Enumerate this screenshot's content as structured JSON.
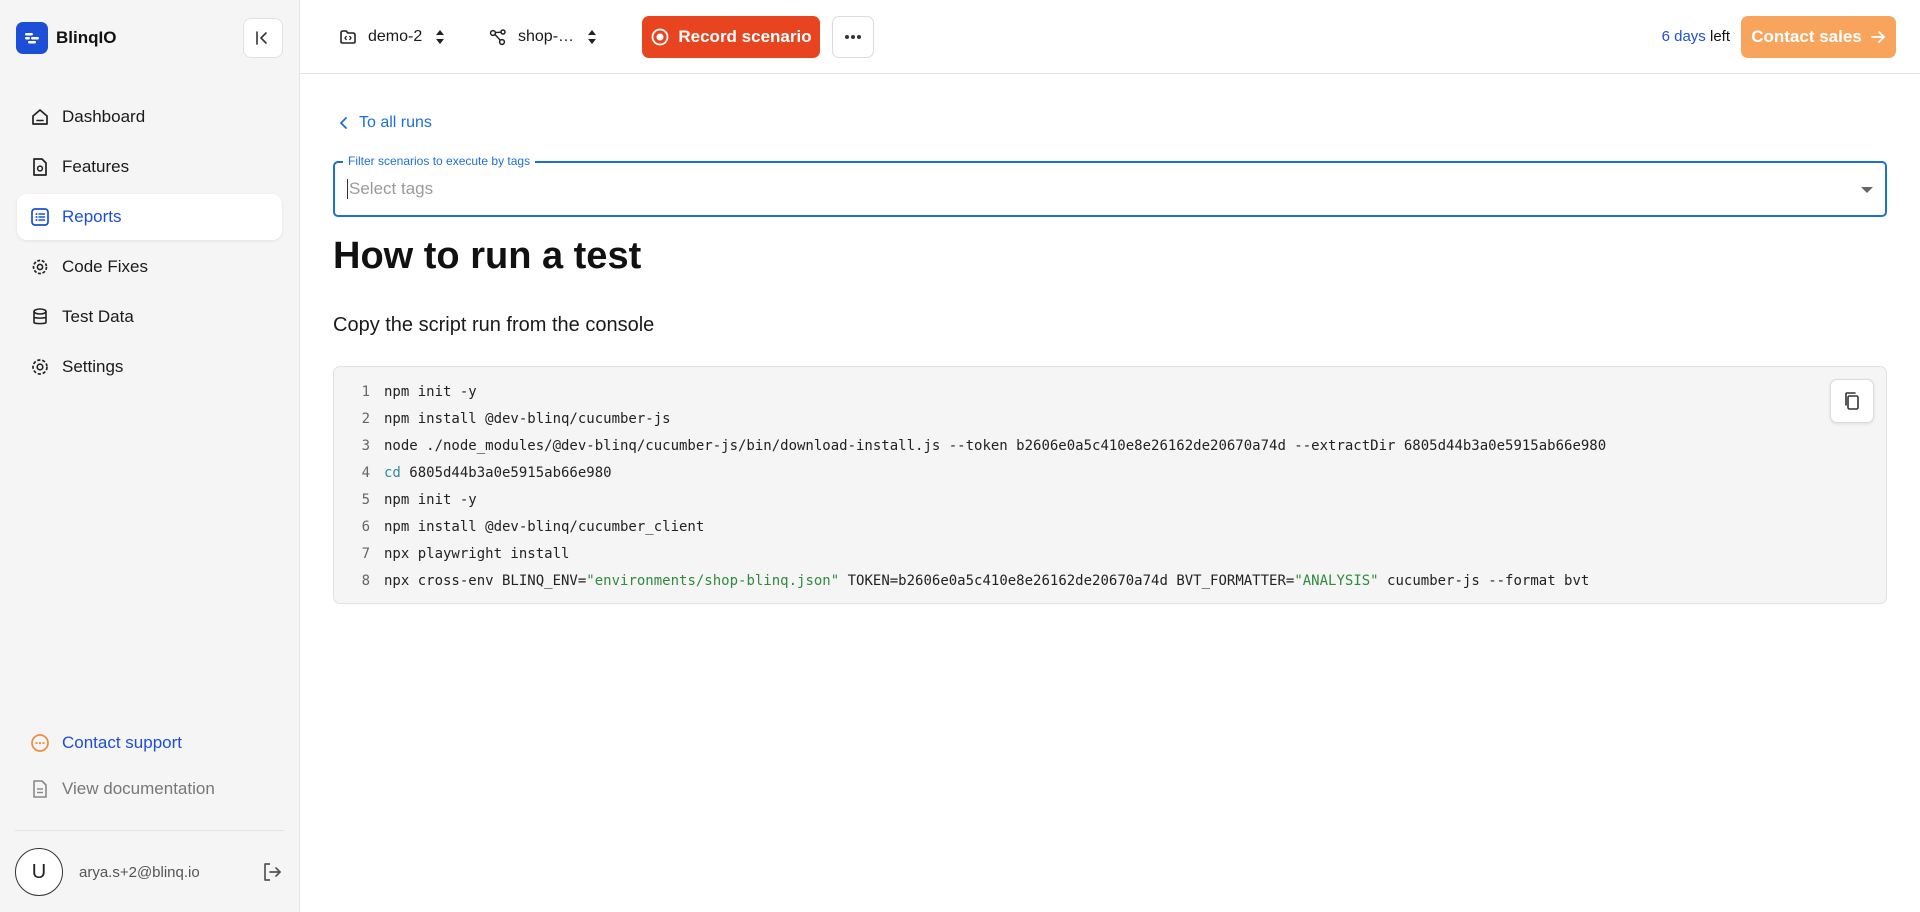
{
  "app": {
    "name": "BlinqIO"
  },
  "sidebar": {
    "items": [
      {
        "label": "Dashboard",
        "icon": "home-icon",
        "active": false
      },
      {
        "label": "Features",
        "icon": "feature-file-icon",
        "active": false
      },
      {
        "label": "Reports",
        "icon": "report-list-icon",
        "active": true
      },
      {
        "label": "Code Fixes",
        "icon": "gear-fix-icon",
        "active": false
      },
      {
        "label": "Test Data",
        "icon": "database-icon",
        "active": false
      },
      {
        "label": "Settings",
        "icon": "settings-gear-icon",
        "active": false
      }
    ],
    "support": {
      "contact_label": "Contact support",
      "docs_label": "View documentation"
    },
    "user": {
      "initial": "U",
      "email": "arya.s+2@blinq.io"
    }
  },
  "topbar": {
    "project": "demo-2",
    "environment": "shop-…",
    "record_label": "Record scenario",
    "trial_days": "6 days",
    "trial_suffix": " left",
    "contact_sales_label": "Contact sales"
  },
  "main": {
    "back_label": "To all runs",
    "filter": {
      "legend": "Filter scenarios to execute by tags",
      "placeholder": "Select tags"
    },
    "heading": "How to run a test",
    "subheading": "Copy the script run from the console",
    "code_lines": [
      {
        "n": "1",
        "parts": [
          {
            "t": "npm init -y",
            "c": "code"
          }
        ]
      },
      {
        "n": "2",
        "parts": [
          {
            "t": "npm install @dev-blinq/cucumber-js",
            "c": "code"
          }
        ]
      },
      {
        "n": "3",
        "parts": [
          {
            "t": "node ./node_modules/@dev-blinq/cucumber-js/bin/download-install.js --token b2606e0a5c410e8e26162de20670a74d --extractDir 6805d44b3a0e5915ab66e980",
            "c": "code"
          }
        ]
      },
      {
        "n": "4",
        "parts": [
          {
            "t": "cd",
            "c": "kw"
          },
          {
            "t": " 6805d44b3a0e5915ab66e980",
            "c": "code"
          }
        ]
      },
      {
        "n": "5",
        "parts": [
          {
            "t": "npm init -y",
            "c": "code"
          }
        ]
      },
      {
        "n": "6",
        "parts": [
          {
            "t": "npm install @dev-blinq/cucumber_client",
            "c": "code"
          }
        ]
      },
      {
        "n": "7",
        "parts": [
          {
            "t": "npx playwright install",
            "c": "code"
          }
        ]
      },
      {
        "n": "8",
        "parts": [
          {
            "t": "npx cross-env BLINQ_ENV=",
            "c": "code"
          },
          {
            "t": "\"environments/shop-blinq.json\"",
            "c": "str"
          },
          {
            "t": " TOKEN=b2606e0a5c410e8e26162de20670a74d BVT_FORMATTER=",
            "c": "code"
          },
          {
            "t": "\"ANALYSIS\"",
            "c": "str"
          },
          {
            "t": " cucumber-js --format bvt",
            "c": "code"
          }
        ]
      }
    ]
  },
  "colors": {
    "brand_blue": "#1d4ed8",
    "record_red": "#e8441f",
    "sales_orange": "#f8a45c",
    "focus_blue": "#1d6fd6"
  }
}
